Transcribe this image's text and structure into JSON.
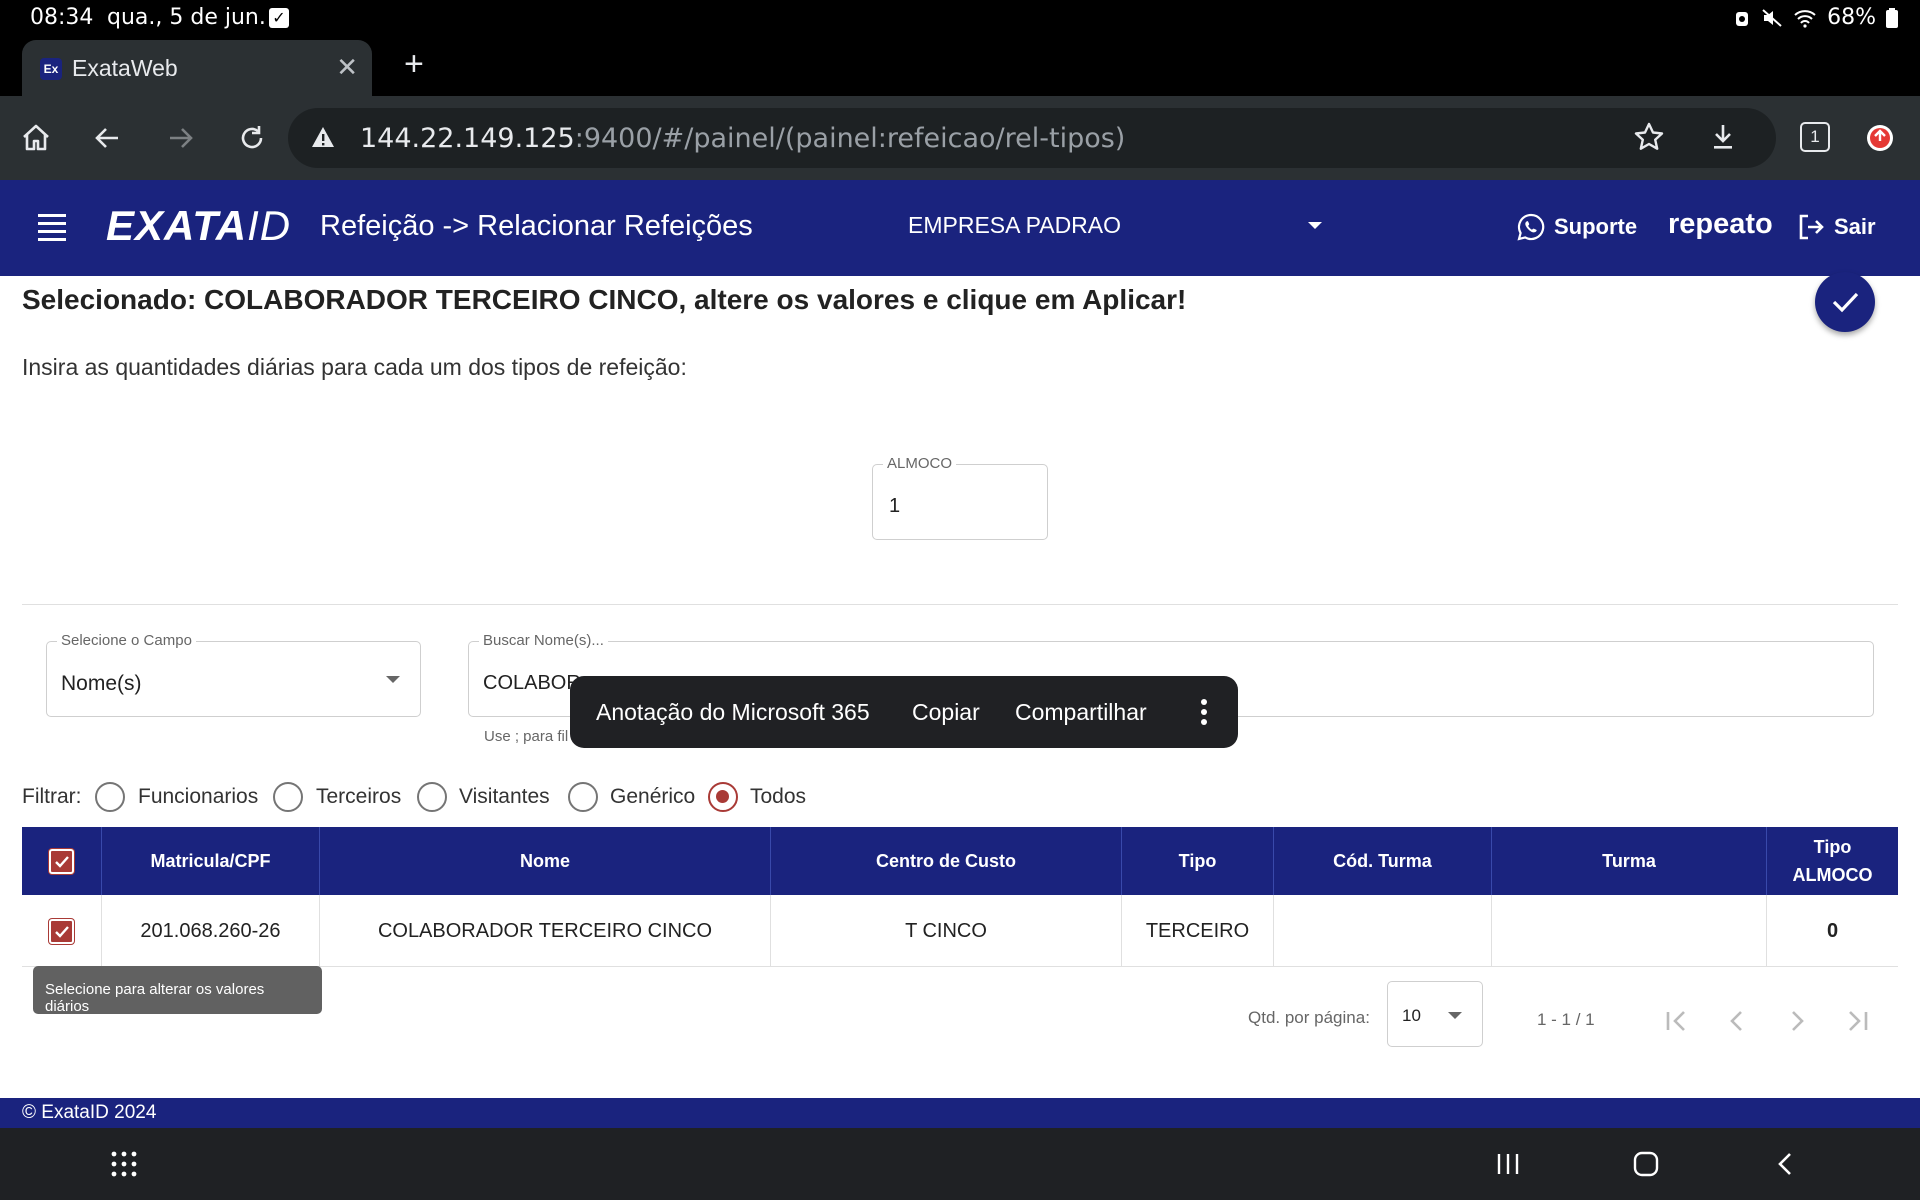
{
  "status_bar": {
    "time": "08:34",
    "date": "qua., 5 de jun.",
    "battery": "68%"
  },
  "browser": {
    "tab_title": "ExataWeb",
    "favicon_text": "Ex",
    "url_host": "144.22.149.125",
    "url_rest": ":9400/#/painel/(painel:refeicao/rel-tipos)",
    "tab_count": "1"
  },
  "app": {
    "logo_main": "EXATA",
    "logo_id": "ID",
    "page_title": "Refeição -> Relacionar Refeições",
    "company": "EMPRESA PADRAO",
    "support_label": "Suporte",
    "username": "repeato",
    "logout_label": "Sair",
    "brand_color": "#1a237e",
    "accent_color": "#a93a36"
  },
  "main": {
    "selected_text": "Selecionado: COLABORADOR TERCEIRO CINCO, altere os valores e clique em Aplicar!",
    "instructions": "Insira as quantidades diárias para cada um dos tipos de refeição:",
    "almoco_label": "ALMOCO",
    "almoco_value": "1"
  },
  "search": {
    "campo_label": "Selecione o Campo",
    "campo_value": "Nome(s)",
    "search_label": "Buscar Nome(s)...",
    "search_value": "COLABOR",
    "hint": "Use ; para fil"
  },
  "context_menu": {
    "items": [
      "Anotação do Microsoft 365",
      "Copiar",
      "Compartilhar"
    ]
  },
  "filter": {
    "label": "Filtrar:",
    "options": [
      "Funcionarios",
      "Terceiros",
      "Visitantes",
      "Genérico",
      "Todos"
    ],
    "selected": "Todos"
  },
  "table": {
    "headers": [
      "Matricula/CPF",
      "Nome",
      "Centro de Custo",
      "Tipo",
      "Cód. Turma",
      "Turma"
    ],
    "last_header_line1": "Tipo",
    "last_header_line2": "ALMOCO",
    "rows": [
      {
        "matricula": "201.068.260-26",
        "nome": "COLABORADOR TERCEIRO CINCO",
        "centro_custo": "T CINCO",
        "tipo": "TERCEIRO",
        "cod_turma": "",
        "turma": "",
        "tipo_almoco": "0"
      }
    ]
  },
  "tooltip": "Selecione para alterar os valores diários",
  "paginator": {
    "label": "Qtd. por página:",
    "page_size": "10",
    "range": "1 - 1 / 1"
  },
  "footer": "© ExataID 2024"
}
